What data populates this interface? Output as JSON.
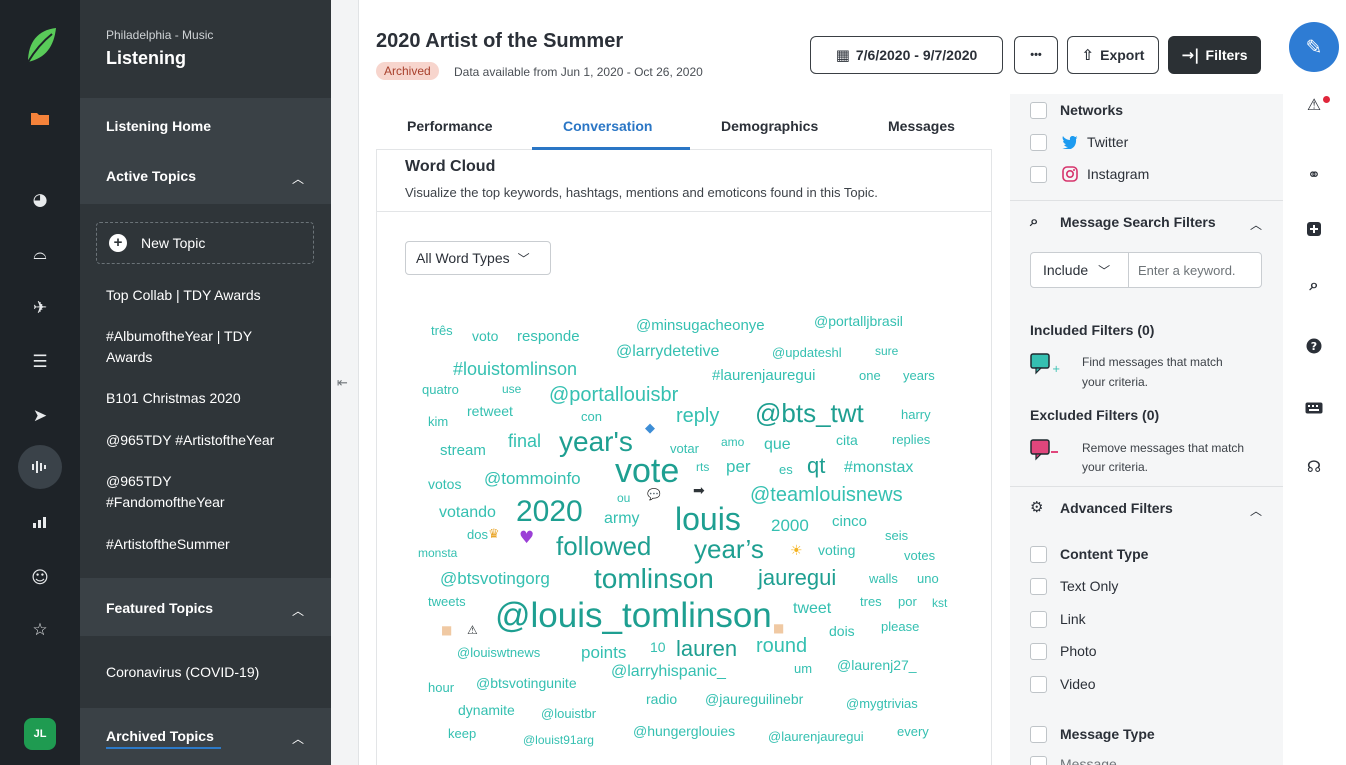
{
  "nav": {
    "org": "Philadelphia - Music",
    "title": "Listening",
    "home": "Listening Home",
    "active_topics": "Active Topics",
    "new_topic": "New Topic",
    "topics": [
      "Top Collab | TDY Awards",
      "#AlbumoftheYear | TDY",
      "Awards",
      "B101 Christmas 2020",
      "@965TDY #ArtistoftheYear",
      "@965TDY",
      "#FandomoftheYear",
      "#ArtistoftheSummer"
    ],
    "featured_topics": "Featured Topics",
    "featured": [
      "Coronavirus (COVID-19)"
    ],
    "archived_topics": "Archived Topics",
    "avatar": "JL"
  },
  "header": {
    "title": "2020 Artist of the Summer",
    "badge": "Archived",
    "availability": "Data available from Jun 1, 2020 - Oct 26, 2020",
    "date_range": "7/6/2020 - 9/7/2020",
    "more": "•••",
    "export": "Export",
    "filters": "Filters"
  },
  "tabs": [
    "Performance",
    "Conversation",
    "Demographics",
    "Messages"
  ],
  "wordcloud": {
    "title": "Word Cloud",
    "description": "Visualize the top keywords, hashtags, mentions and emoticons found in this Topic.",
    "word_type": "All Word Types",
    "words": [
      "três",
      "voto",
      "responde",
      "@minsugacheonye",
      "@portalljbrasil",
      "@larrydetetive",
      "@updateshl",
      "sure",
      "#louistomlinson",
      "#laurenjauregui",
      "one",
      "years",
      "quatro",
      "use",
      "@portallouisbr",
      "kim",
      "retweet",
      "con",
      "reply",
      "@bts_twt",
      "harry",
      "stream",
      "final",
      "year's",
      "votar",
      "amo",
      "que",
      "cita",
      "replies",
      "votos",
      "@tommoinfo",
      "vote",
      "rts",
      "per",
      "es",
      "qt",
      "#monstax",
      "ou",
      "@teamlouisnews",
      "votando",
      "2020",
      "army",
      "louis",
      "2000",
      "cinco",
      "dos",
      "seis",
      "monsta",
      "followed",
      "year’s",
      "voting",
      "votes",
      "@btsvotingorg",
      "tomlinson",
      "jauregui",
      "walls",
      "uno",
      "tweets",
      "tweet",
      "tres",
      "por",
      "kst",
      "@louis_tomlinson",
      "dois",
      "please",
      "@louiswtnews",
      "points",
      "10",
      "lauren",
      "round",
      "um",
      "@laurenj27_",
      "hour",
      "@btsvotingunite",
      "@larryhispanic_",
      "radio",
      "@jaureguilinebr",
      "@mygtrivias",
      "dynamite",
      "@louistbr",
      "keep",
      "@louist91arg",
      "@hungerglouies",
      "@laurenjauregui",
      "every"
    ]
  },
  "filters": {
    "networks": "Networks",
    "twitter": "Twitter",
    "instagram": "Instagram",
    "search_filters": "Message Search Filters",
    "include": "Include",
    "keyword_placeholder": "Enter a keyword.",
    "included": "Included Filters (0)",
    "included_hint": [
      "Find messages that match",
      "your criteria."
    ],
    "excluded": "Excluded Filters (0)",
    "excluded_hint": [
      "Remove messages that match",
      "your criteria."
    ],
    "advanced": "Advanced Filters",
    "content_type": "Content Type",
    "content_options": [
      "Text Only",
      "Link",
      "Photo",
      "Video"
    ],
    "message_type": "Message Type",
    "message_partial": "Message"
  },
  "colors": {
    "accent": "#2a76c5",
    "cloud": "#35c0b1",
    "compose": "#2e7cd4",
    "alert": "#e0263b"
  }
}
